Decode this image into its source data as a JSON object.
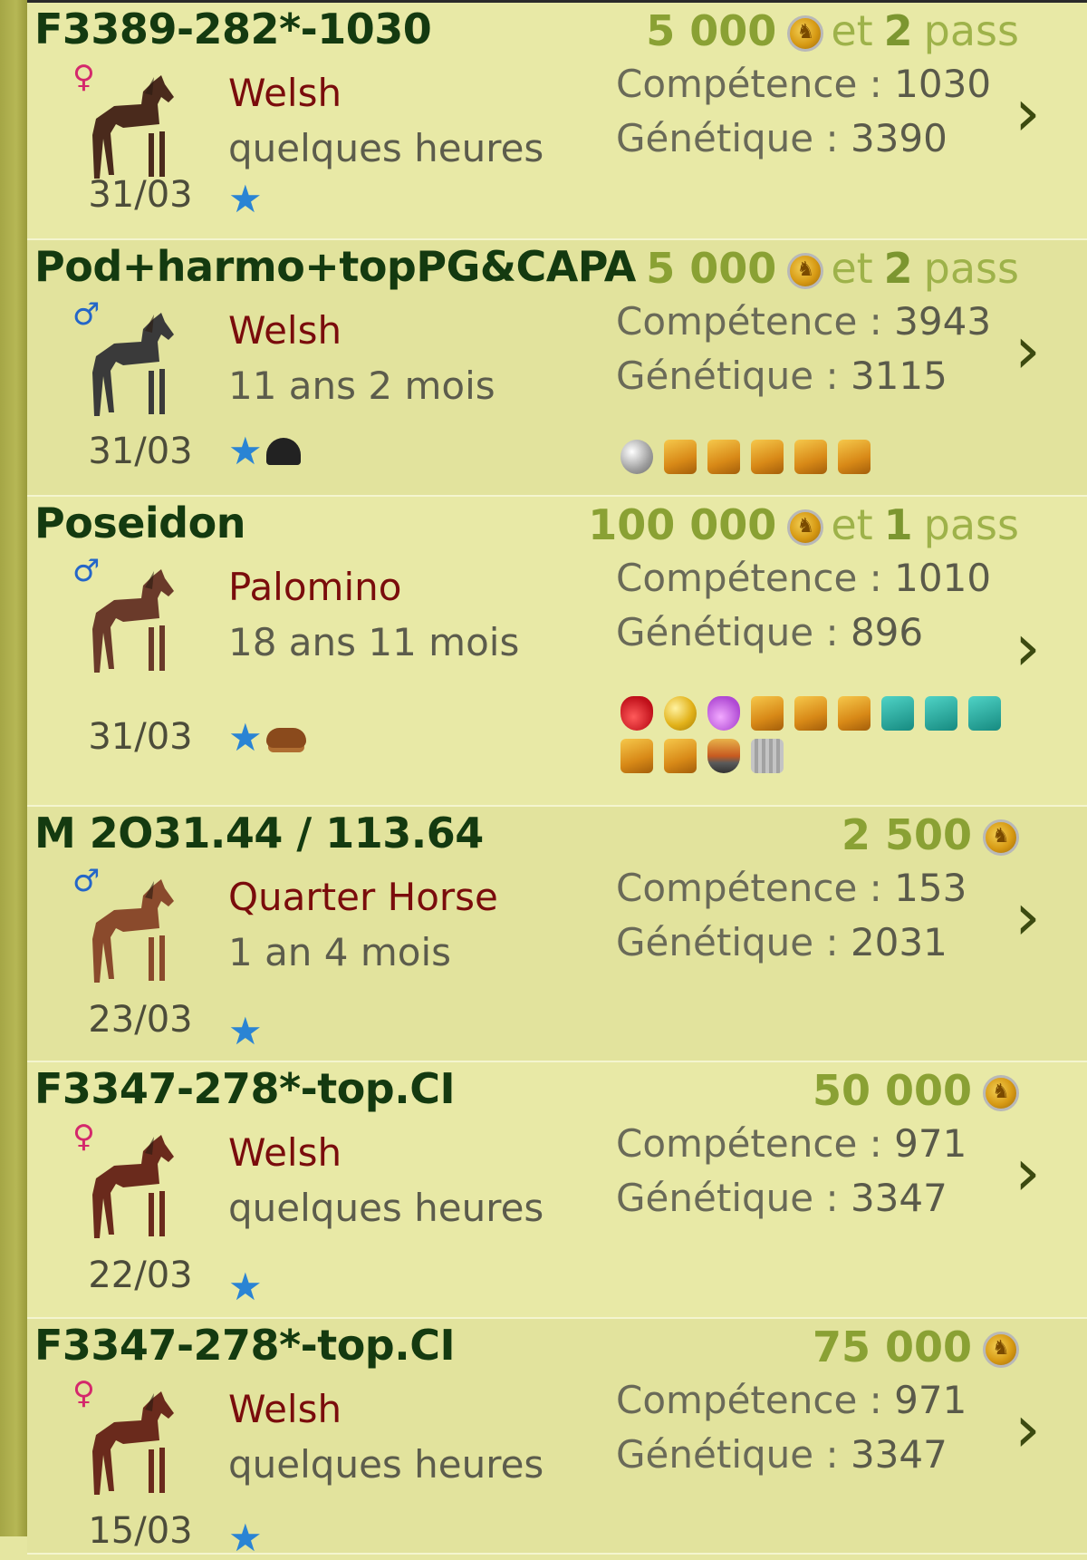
{
  "listings": [
    {
      "name": "F3389-282*-1030",
      "price": "5 000",
      "et": "et",
      "pass_count": "2",
      "pass_label": "pass",
      "gender": "♀",
      "gender_type": "female",
      "breed": "Welsh",
      "age": "quelques heures",
      "date": "31/03",
      "competence": "1030",
      "genetique": "3390",
      "badges": [
        "star-icon"
      ],
      "items": [],
      "horse_color": "#4a2a1c"
    },
    {
      "name": "Pod+harmo+topPG&CAPA",
      "price": "5 000",
      "et": "et",
      "pass_count": "2",
      "pass_label": "pass",
      "gender": "♂",
      "gender_type": "male",
      "breed": "Welsh",
      "age": "11 ans 2 mois",
      "date": "31/03",
      "competence": "3943",
      "genetique": "3115",
      "badges": [
        "star-icon",
        "helmet-icon"
      ],
      "items": [
        "silver-apple-icon",
        "golden-horse-head-icon",
        "golden-harp-icon",
        "golden-pyramid-icon",
        "golden-trophy-icon",
        "golden-box-icon"
      ],
      "horse_color": "#3a3a3a"
    },
    {
      "name": "Poseidon",
      "price": "100 000",
      "et": "et",
      "pass_count": "1",
      "pass_label": "pass",
      "gender": "♂",
      "gender_type": "male",
      "breed": "Palomino",
      "age": "18 ans 11 mois",
      "date": "31/03",
      "competence": "1010",
      "genetique": "896",
      "badges": [
        "star-icon",
        "cowboy-hat-icon"
      ],
      "items": [
        "red-potion-icon",
        "golden-apple-icon",
        "violet-potion-icon",
        "golden-fleece-icon",
        "golden-horse-head-icon",
        "golden-harp-icon",
        "horseshoe-icon",
        "teal-bird-icon",
        "teal-boot-icon",
        "golden-pyramid-icon",
        "golden-trophy-icon",
        "fruit-bowl-icon",
        "teal-wings-icon"
      ],
      "horse_color": "#6a3a2a"
    },
    {
      "name": "M 2O31.44 / 113.64",
      "price": "2 500",
      "et": "",
      "pass_count": "",
      "pass_label": "",
      "gender": "♂",
      "gender_type": "male",
      "breed": "Quarter Horse",
      "age": "1 an 4 mois",
      "date": "23/03",
      "competence": "153",
      "genetique": "2031",
      "badges": [
        "star-icon"
      ],
      "items": [],
      "horse_color": "#8a4a2c"
    },
    {
      "name": "F3347-278*-top.CI",
      "price": "50 000",
      "et": "",
      "pass_count": "",
      "pass_label": "",
      "gender": "♀",
      "gender_type": "female",
      "breed": "Welsh",
      "age": "quelques heures",
      "date": "22/03",
      "competence": "971",
      "genetique": "3347",
      "badges": [
        "star-icon"
      ],
      "items": [],
      "horse_color": "#6a2a1c"
    },
    {
      "name": "F3347-278*-top.CI",
      "price": "75 000",
      "et": "",
      "pass_count": "",
      "pass_label": "",
      "gender": "♀",
      "gender_type": "female",
      "breed": "Welsh",
      "age": "quelques heures",
      "date": "15/03",
      "competence": "971",
      "genetique": "3347",
      "badges": [
        "star-icon"
      ],
      "items": [],
      "horse_color": "#6a2a1c"
    }
  ],
  "labels": {
    "competence": "Compétence : ",
    "genetique": "Génétique : ",
    "chevron": "›",
    "star": "★"
  }
}
